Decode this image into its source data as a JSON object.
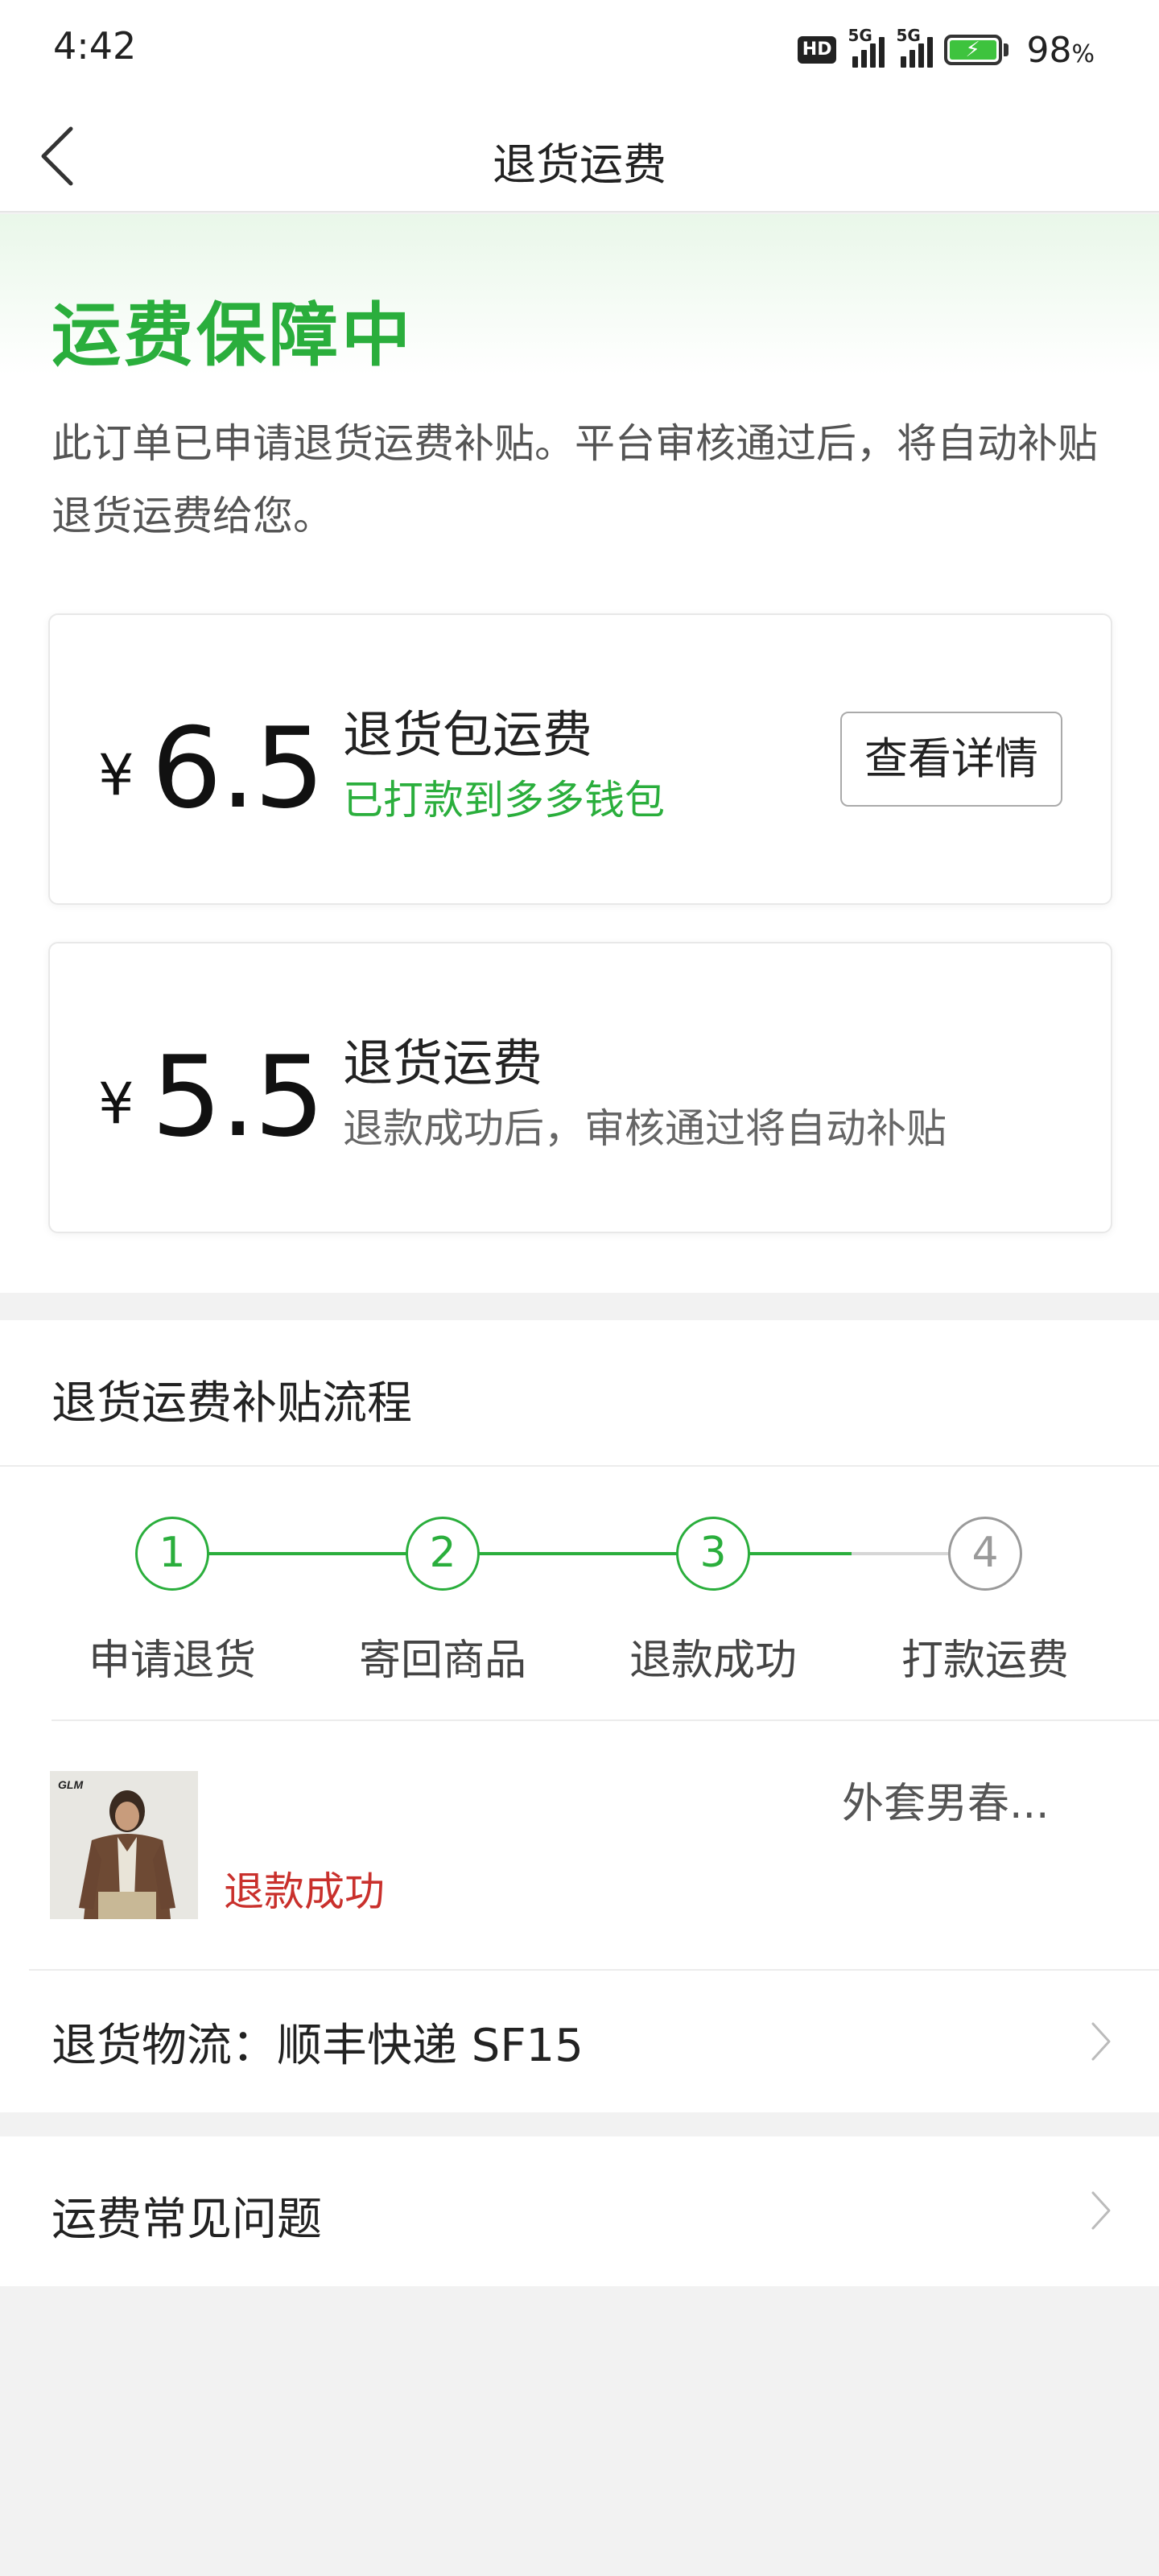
{
  "status_bar": {
    "time": "4:42",
    "network_badge": "HD",
    "signal_1_label": "5G",
    "signal_2_label": "5G",
    "battery_percent": "98",
    "battery_unit": "%"
  },
  "nav": {
    "back_icon": "chevron-left-icon",
    "title": "退货运费"
  },
  "hero": {
    "title": "运费保障中",
    "description": "此订单已申请退货运费补贴。平台审核通过后，将自动补贴退货运费给您。"
  },
  "cards": [
    {
      "currency": "¥",
      "amount": "6.5",
      "title": "退货包运费",
      "subtitle": "已打款到多多钱包",
      "subtitle_color": "#2aae3c",
      "button_label": "查看详情"
    },
    {
      "currency": "¥",
      "amount": "5.5",
      "title": "退货运费",
      "subtitle": "退款成功后，审核通过将自动补贴"
    }
  ],
  "process": {
    "title": "退货运费补贴流程",
    "steps": [
      {
        "number": "1",
        "label": "申请退货",
        "completed": true
      },
      {
        "number": "2",
        "label": "寄回商品",
        "completed": true
      },
      {
        "number": "3",
        "label": "退款成功",
        "completed": true
      },
      {
        "number": "4",
        "label": "打款运费",
        "completed": false
      }
    ]
  },
  "product": {
    "image_brand_text": "GLM",
    "name": "外套男春...",
    "status": "退款成功",
    "status_color": "#c9302c"
  },
  "logistics": {
    "text": "退货物流：顺丰快递 SF15",
    "chevron_icon": "chevron-right-icon"
  },
  "faq": {
    "text": "运费常见问题",
    "chevron_icon": "chevron-right-icon"
  },
  "colors": {
    "accent_green": "#2aae3c",
    "refund_red": "#c9302c",
    "page_bg": "#f2f2f2"
  }
}
